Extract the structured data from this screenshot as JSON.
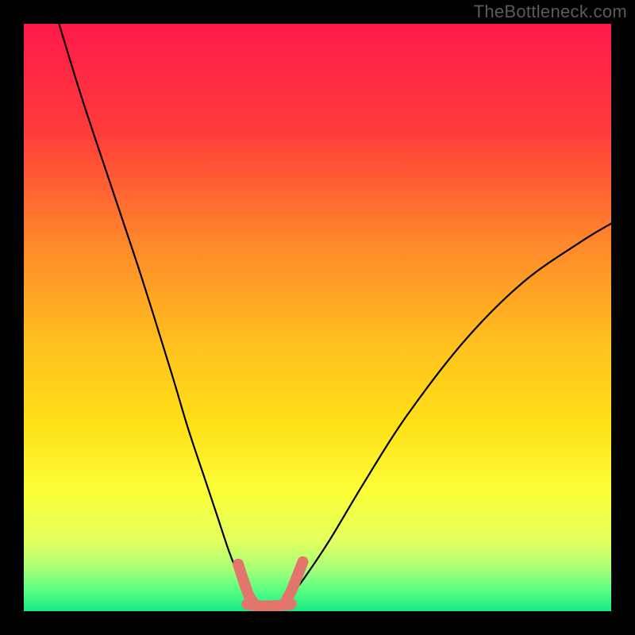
{
  "watermark": "TheBottleneck.com",
  "colors": {
    "top": "#ff1a4a",
    "mid_upper": "#ff8a2a",
    "mid": "#ffe017",
    "mid_lower": "#f6ff66",
    "green_light": "#a4ff7a",
    "green_bright": "#2bff84",
    "curve": "#000000",
    "salmon": "#e2766c",
    "frame": "#000000"
  },
  "chart_data": {
    "type": "line",
    "title": "",
    "xlabel": "",
    "ylabel": "",
    "xlim": [
      0,
      100
    ],
    "ylim": [
      0,
      100
    ],
    "series": [
      {
        "name": "left-curve",
        "x": [
          6,
          10,
          15,
          20,
          25,
          28,
          31,
          33,
          35,
          37,
          38.5
        ],
        "y": [
          100,
          87,
          72,
          57,
          41,
          31,
          22,
          16,
          10,
          5,
          2
        ]
      },
      {
        "name": "right-curve",
        "x": [
          45,
          48,
          52,
          58,
          65,
          75,
          85,
          95,
          100
        ],
        "y": [
          2,
          6,
          12,
          22,
          33,
          46,
          56,
          63,
          66
        ]
      },
      {
        "name": "salmon-left-tip",
        "x": [
          36.5,
          37.4,
          38.3,
          39.0
        ],
        "y": [
          8,
          5.2,
          2.7,
          1.6
        ]
      },
      {
        "name": "salmon-bottom",
        "x": [
          38.0,
          40.0,
          42.0,
          44.0,
          45.5
        ],
        "y": [
          1.2,
          0.9,
          0.9,
          1.0,
          1.2
        ]
      },
      {
        "name": "salmon-right-tip",
        "x": [
          44.5,
          45.6,
          46.6,
          47.5
        ],
        "y": [
          1.5,
          3.6,
          6.1,
          8.4
        ]
      }
    ],
    "gradient_stops": [
      {
        "offset": 0.0,
        "color": "#ff1a4a"
      },
      {
        "offset": 0.18,
        "color": "#ff3b3b"
      },
      {
        "offset": 0.38,
        "color": "#ff8a2a"
      },
      {
        "offset": 0.55,
        "color": "#ffc21e"
      },
      {
        "offset": 0.68,
        "color": "#ffe017"
      },
      {
        "offset": 0.8,
        "color": "#fbff3a"
      },
      {
        "offset": 0.88,
        "color": "#e4ff5e"
      },
      {
        "offset": 0.93,
        "color": "#a4ff7a"
      },
      {
        "offset": 0.965,
        "color": "#56ff83"
      },
      {
        "offset": 1.0,
        "color": "#18e886"
      }
    ]
  }
}
